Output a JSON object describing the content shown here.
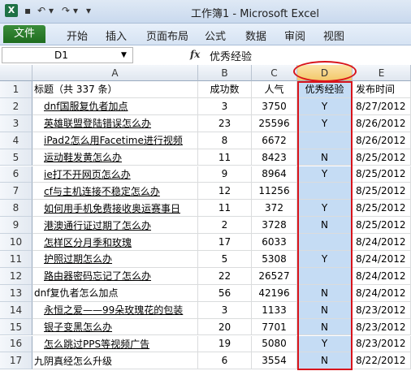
{
  "window": {
    "title": "工作簿1 - Microsoft Excel",
    "app_icon": "X",
    "quick_access": [
      "▾",
      "▾",
      "▾"
    ]
  },
  "ribbon": {
    "file_tab": "文件",
    "tabs": [
      "开始",
      "插入",
      "页面布局",
      "公式",
      "数据",
      "审阅",
      "视图"
    ]
  },
  "formula_bar": {
    "name_box": "D1",
    "fx": "fx",
    "content": "优秀经验"
  },
  "columns": [
    "A",
    "B",
    "C",
    "D",
    "E"
  ],
  "selected_column": "D",
  "header_row": {
    "row": "1",
    "a": "标题（共 337 条）",
    "b": "成功数",
    "c": "人气",
    "d": "优秀经验",
    "e": "发布时间"
  },
  "rows": [
    {
      "row": "2",
      "a": "dnf国服复仇者加点",
      "b": "3",
      "c": "3750",
      "d": "Y",
      "e": "8/27/2012",
      "link": true
    },
    {
      "row": "3",
      "a": "英雄联盟登陆错误怎么办",
      "b": "23",
      "c": "25596",
      "d": "Y",
      "e": "8/26/2012",
      "link": true
    },
    {
      "row": "4",
      "a": "iPad2怎么用Facetime进行视频",
      "b": "8",
      "c": "6672",
      "d": "",
      "e": "8/26/2012",
      "link": true
    },
    {
      "row": "5",
      "a": "运动鞋发黄怎么办",
      "b": "11",
      "c": "8423",
      "d": "N",
      "e": "8/25/2012",
      "link": true
    },
    {
      "row": "6",
      "a": "ie打不开网页怎么办",
      "b": "9",
      "c": "8964",
      "d": "Y",
      "e": "8/25/2012",
      "link": true
    },
    {
      "row": "7",
      "a": "cf与主机连接不稳定怎么办",
      "b": "12",
      "c": "11256",
      "d": "",
      "e": "8/25/2012",
      "link": true
    },
    {
      "row": "8",
      "a": "如何用手机免费接收奥运赛事日",
      "b": "11",
      "c": "372",
      "d": "Y",
      "e": "8/25/2012",
      "link": true
    },
    {
      "row": "9",
      "a": "港澳通行证过期了怎么办",
      "b": "2",
      "c": "3728",
      "d": "N",
      "e": "8/25/2012",
      "link": true
    },
    {
      "row": "10",
      "a": "怎样区分月季和玫瑰",
      "b": "17",
      "c": "6033",
      "d": "",
      "e": "8/24/2012",
      "link": true
    },
    {
      "row": "11",
      "a": "护照过期怎么办",
      "b": "5",
      "c": "5308",
      "d": "Y",
      "e": "8/24/2012",
      "link": true
    },
    {
      "row": "12",
      "a": "路由器密码忘记了怎么办",
      "b": "22",
      "c": "26527",
      "d": "",
      "e": "8/24/2012",
      "link": true
    },
    {
      "row": "13",
      "a": "dnf复仇者怎么加点",
      "b": "56",
      "c": "42196",
      "d": "N",
      "e": "8/24/2012",
      "link": false
    },
    {
      "row": "14",
      "a": "永恒之爱——99朵玫瑰花的包装",
      "b": "3",
      "c": "1133",
      "d": "N",
      "e": "8/23/2012",
      "link": true
    },
    {
      "row": "15",
      "a": "银子变黑怎么办",
      "b": "20",
      "c": "7701",
      "d": "N",
      "e": "8/23/2012",
      "link": true
    },
    {
      "row": "16",
      "a": "怎么跳过PPS等视频广告",
      "b": "19",
      "c": "5080",
      "d": "Y",
      "e": "8/23/2012",
      "link": true
    },
    {
      "row": "17",
      "a": "九阴真经怎么升级",
      "b": "6",
      "c": "3554",
      "d": "N",
      "e": "8/22/2012",
      "link": false
    }
  ]
}
